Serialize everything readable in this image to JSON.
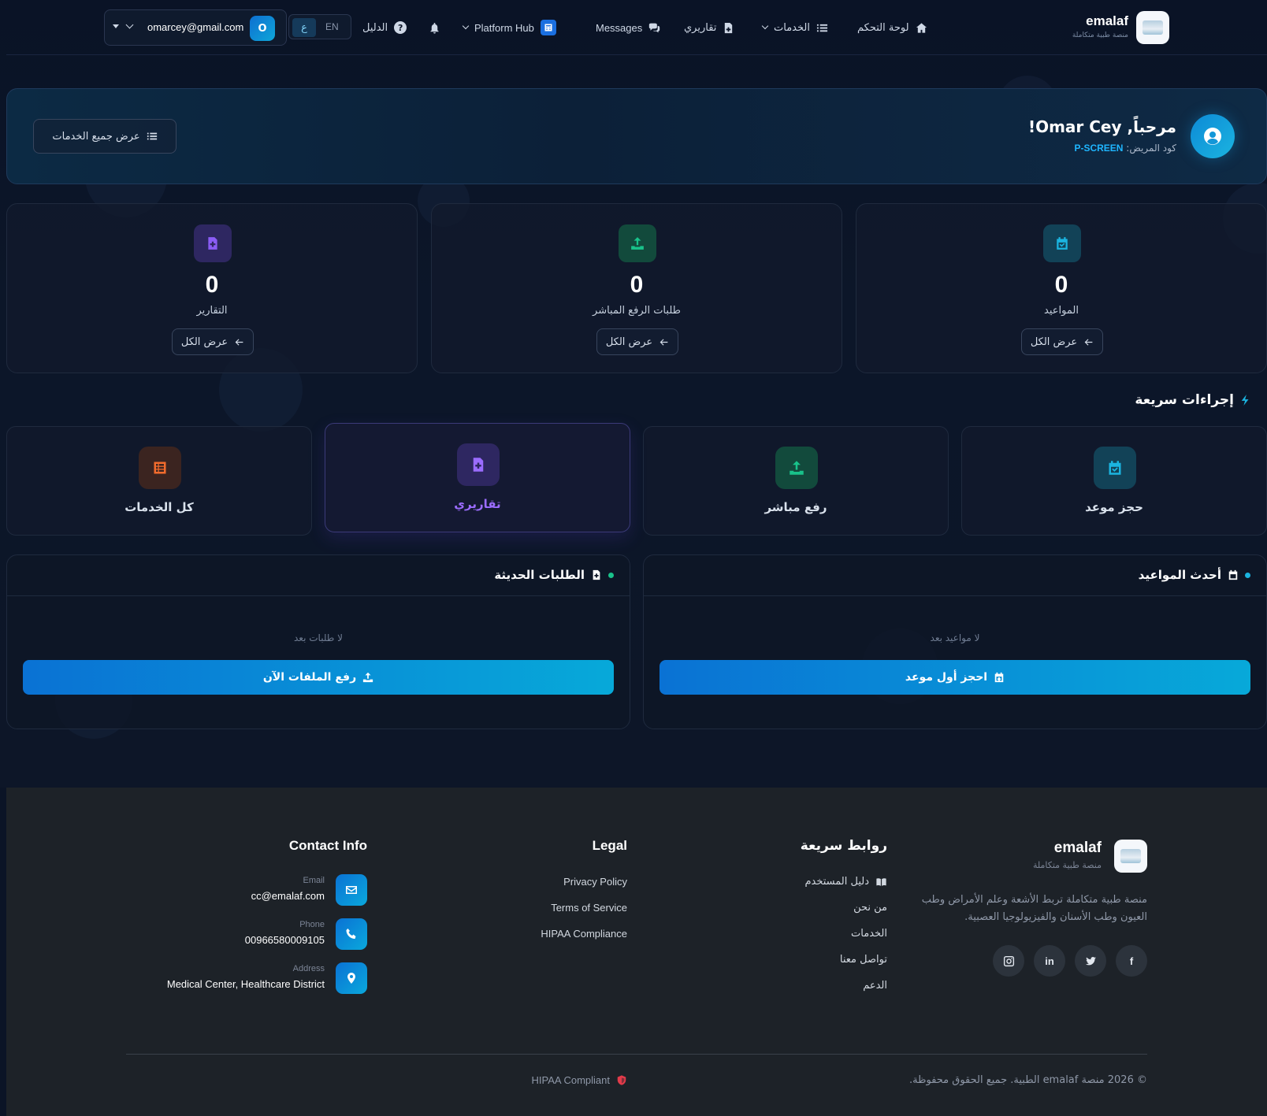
{
  "nav": {
    "brand_name": "emalaf",
    "brand_sub": "منصة طبية متكاملة",
    "dashboard": "لوحة التحكم",
    "services": "الخدمات",
    "reports": "تقاريري",
    "messages": "Messages",
    "platform_hub": "Platform Hub",
    "guide": "الدليل",
    "lang_ar": "ع",
    "lang_en": "EN",
    "user_email": "omarcey@gmail.com",
    "user_initial": "O"
  },
  "welcome": {
    "title": "مرحباً, Omar Cey!",
    "code_label": "كود المريض:",
    "code_value": "P-SCREEN",
    "all_services_button": "عرض جميع الخدمات"
  },
  "stats": [
    {
      "label": "المواعيد",
      "value": "0",
      "button": "عرض الكل",
      "color": "#1bb4e0"
    },
    {
      "label": "طلبات الرفع المباشر",
      "value": "0",
      "button": "عرض الكل",
      "color": "#19c28a"
    },
    {
      "label": "التقارير",
      "value": "0",
      "button": "عرض الكل",
      "color": "#8b5cf6"
    }
  ],
  "quick_actions": {
    "title": "إجراءات سريعة",
    "items": [
      {
        "label": "حجز موعد",
        "color": "#1bb4e0"
      },
      {
        "label": "رفع مباشر",
        "color": "#19c28a"
      },
      {
        "label": "تقاريري",
        "color": "#9b6cff"
      },
      {
        "label": "كل الخدمات",
        "color": "#f26b2d"
      }
    ]
  },
  "recent": {
    "appointments": {
      "title": "أحدث المواعيد",
      "empty": "لا مواعيد بعد",
      "button": "احجز أول موعد"
    },
    "requests": {
      "title": "الطلبات الحديثة",
      "empty": "لا طلبات بعد",
      "button": "رفع الملفات الآن"
    }
  },
  "footer": {
    "brand_name": "emalaf",
    "brand_sub": "منصة طبية متكاملة",
    "description": "منصة طبية متكاملة تربط الأشعة وعلم الأمراض وطب العيون وطب الأسنان والفيزيولوجيا العصبية.",
    "quick_links_title": "روابط سريعة",
    "quick_links": [
      "دليل المستخدم",
      "من نحن",
      "الخدمات",
      "تواصل معنا",
      "الدعم"
    ],
    "legal_title": "Legal",
    "legal_links": [
      "Privacy Policy",
      "Terms of Service",
      "HIPAA Compliance"
    ],
    "contact_title": "Contact Info",
    "email_label": "Email",
    "email": "cc@emalaf.com",
    "phone_label": "Phone",
    "phone": "00966580009105",
    "address_label": "Address",
    "address": "Medical Center, Healthcare District",
    "copyright": "© 2026 منصة emalaf الطبية. جميع الحقوق محفوظة.",
    "hipaa": "HIPAA Compliant"
  }
}
